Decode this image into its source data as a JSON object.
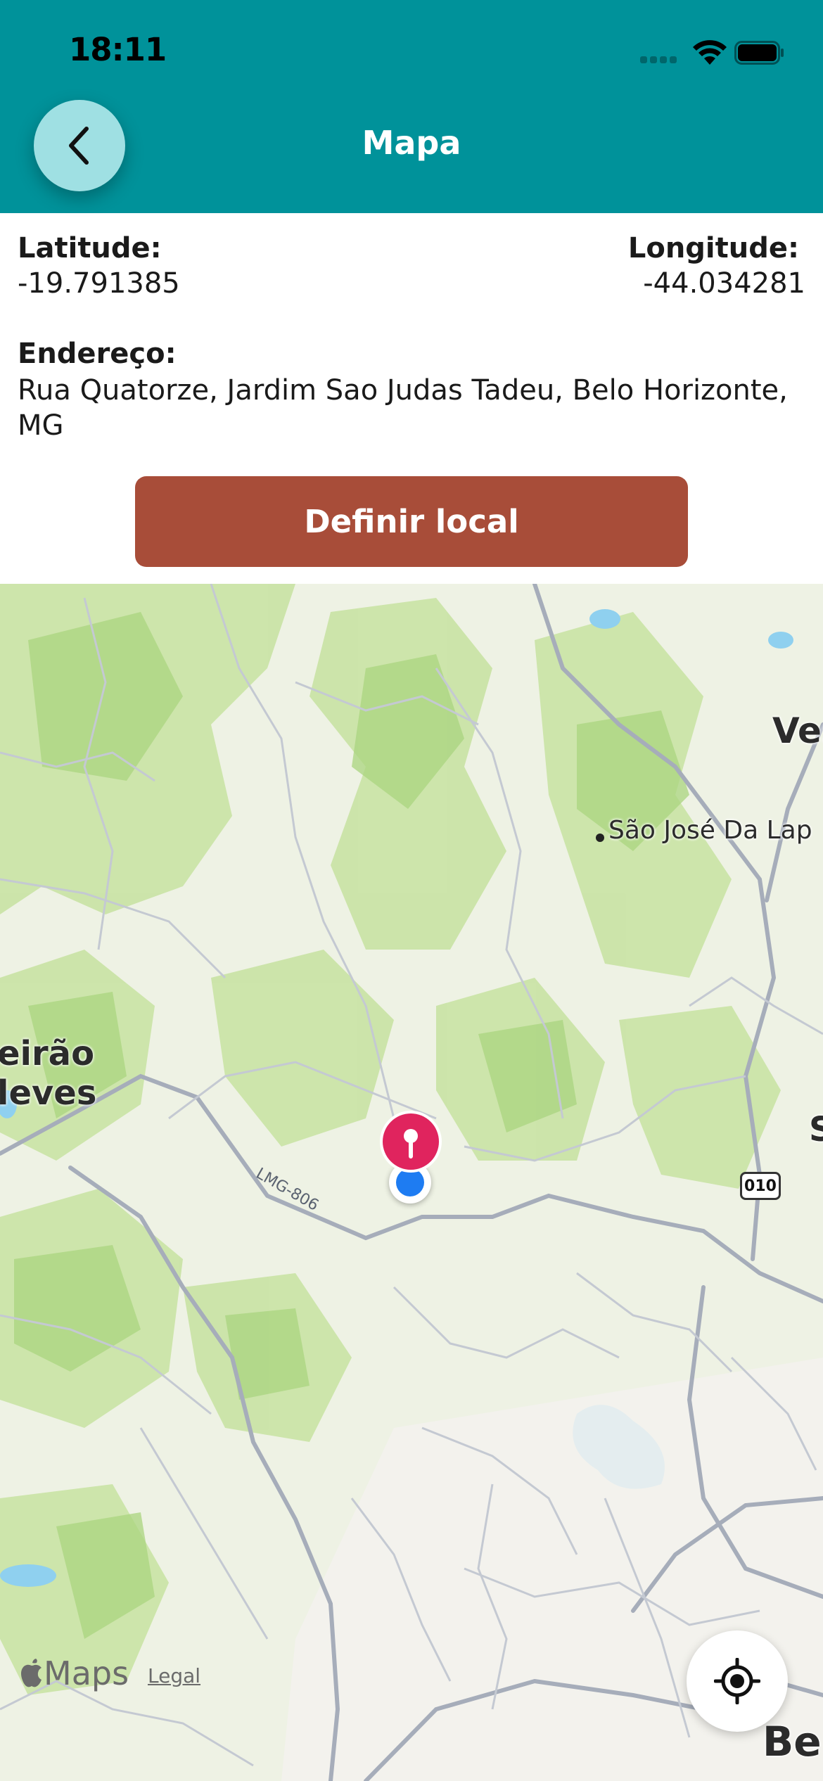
{
  "status_bar": {
    "time": "18:11"
  },
  "header": {
    "title": "Mapa",
    "back_icon": "chevron-left-icon",
    "background": "#00929a"
  },
  "info": {
    "latitude_label": "Latitude:",
    "latitude_value": "-19.791385",
    "longitude_label": "Longitude:",
    "longitude_value": "-44.034281",
    "address_label": "Endereço:",
    "address_value": "Rua Quatorze, Jardim Sao Judas Tadeu, Belo Horizonte, MG"
  },
  "actions": {
    "define_button": "Definir local",
    "button_color": "#a84d39"
  },
  "map": {
    "labels": {
      "place_left_1": "eirão",
      "place_left_2": "leves",
      "place_top_right": "Ves",
      "sao_jose": "São José Da Lap",
      "place_right_mid": "S",
      "place_bottom_right": "Be",
      "road": "LMG-806",
      "shield": "010"
    },
    "maps_brand": "Maps",
    "legal": "Legal",
    "pin_color": "#e0245e",
    "user_location_color": "#1e7cf2",
    "locate_icon": "locate-crosshair-icon"
  }
}
